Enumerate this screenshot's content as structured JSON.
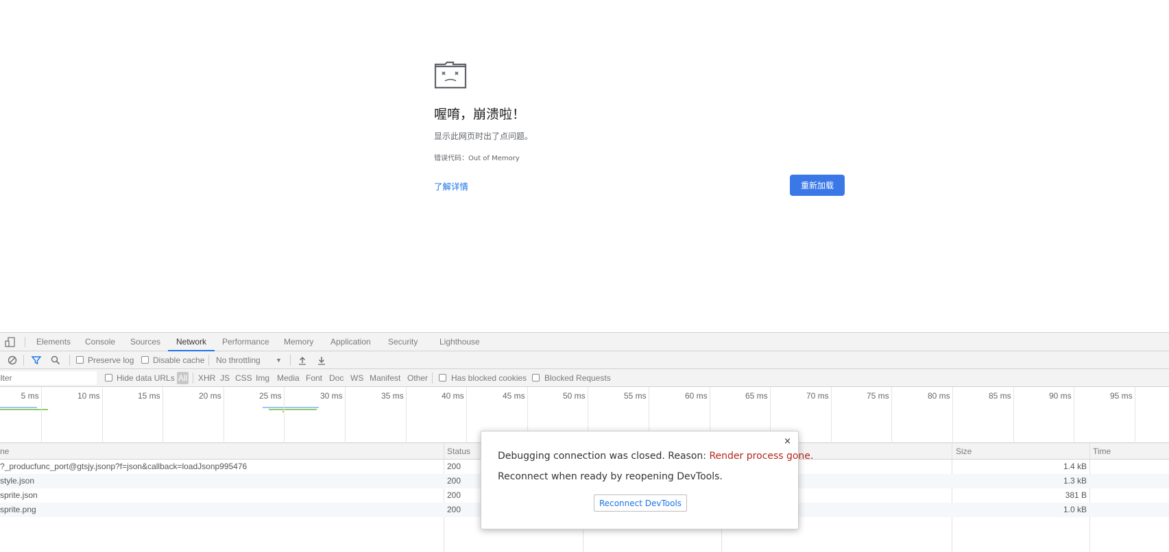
{
  "crash": {
    "icon": "sad-folder-icon",
    "title": "喔唷，崩溃啦！",
    "description": "显示此网页时出了点问题。",
    "error_code": "错误代码：Out of Memory",
    "learn_more": "了解详情",
    "reload_button": "重新加载",
    "reload_color": "#3b78e7"
  },
  "devtools": {
    "tabs": [
      {
        "label": "Elements"
      },
      {
        "label": "Console"
      },
      {
        "label": "Sources"
      },
      {
        "label": "Network",
        "active": true
      },
      {
        "label": "Performance"
      },
      {
        "label": "Memory"
      },
      {
        "label": "Application"
      },
      {
        "label": "Security"
      },
      {
        "label": "Lighthouse"
      }
    ],
    "toolbar": {
      "preserve_log": "Preserve log",
      "disable_cache": "Disable cache",
      "throttling": "No throttling"
    },
    "filterbar": {
      "filter_placeholder": "Filter",
      "hide_data_urls": "Hide data URLs",
      "types": [
        "All",
        "XHR",
        "JS",
        "CSS",
        "Img",
        "Media",
        "Font",
        "Doc",
        "WS",
        "Manifest",
        "Other"
      ],
      "has_blocked_cookies": "Has blocked cookies",
      "blocked_requests": "Blocked Requests"
    },
    "timeline_ticks": [
      "5 ms",
      "10 ms",
      "15 ms",
      "20 ms",
      "25 ms",
      "30 ms",
      "35 ms",
      "40 ms",
      "45 ms",
      "50 ms",
      "55 ms",
      "60 ms",
      "65 ms",
      "70 ms",
      "75 ms",
      "80 ms",
      "85 ms",
      "90 ms",
      "95 ms"
    ],
    "table": {
      "headers": {
        "name": "ne",
        "status": "Status",
        "size": "Size",
        "time": "Time"
      },
      "rows": [
        {
          "name": "?_producfunc_port@gtsjy.jsonp?f=json&callback=loadJsonp995476",
          "status": "200",
          "size": "1.4 kB"
        },
        {
          "name": "style.json",
          "status": "200",
          "size": "1.3 kB"
        },
        {
          "name": "sprite.json",
          "status": "200",
          "size": "381 B"
        },
        {
          "name": "sprite.png",
          "status": "200",
          "size": "1.0 kB"
        }
      ]
    }
  },
  "modal": {
    "line1_prefix": "Debugging connection was closed. Reason: ",
    "line1_reason": "Render process gone.",
    "line2": "Reconnect when ready by reopening DevTools.",
    "button": "Reconnect DevTools",
    "close": "×"
  }
}
